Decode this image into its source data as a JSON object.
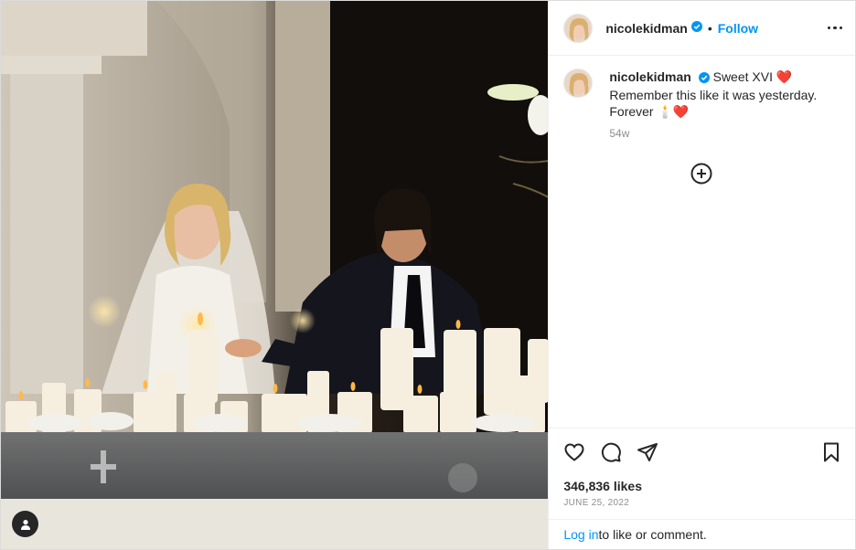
{
  "post": {
    "username": "nicolekidman",
    "follow_label": "Follow",
    "dot": "•",
    "caption_text_1": "Sweet XVI ❤️",
    "caption_text_2": "Remember this like it was yesterday.",
    "caption_text_3": "Forever 🕯️❤️",
    "time_ago": "54w",
    "likes": "346,836 likes",
    "date": "June 25, 2022",
    "login_link": "Log in",
    "login_rest": " to like or comment."
  },
  "colors": {
    "accent": "#0095f6",
    "text": "#262626",
    "muted": "#8e8e8e",
    "border": "#dbdbdb"
  },
  "icons": {
    "verified": "verified-badge-icon",
    "more": "more-options-icon",
    "load_more": "plus-circle-icon",
    "like": "heart-icon",
    "comment": "comment-icon",
    "share": "paper-plane-icon",
    "save": "bookmark-icon",
    "tags": "user-tag-icon"
  }
}
